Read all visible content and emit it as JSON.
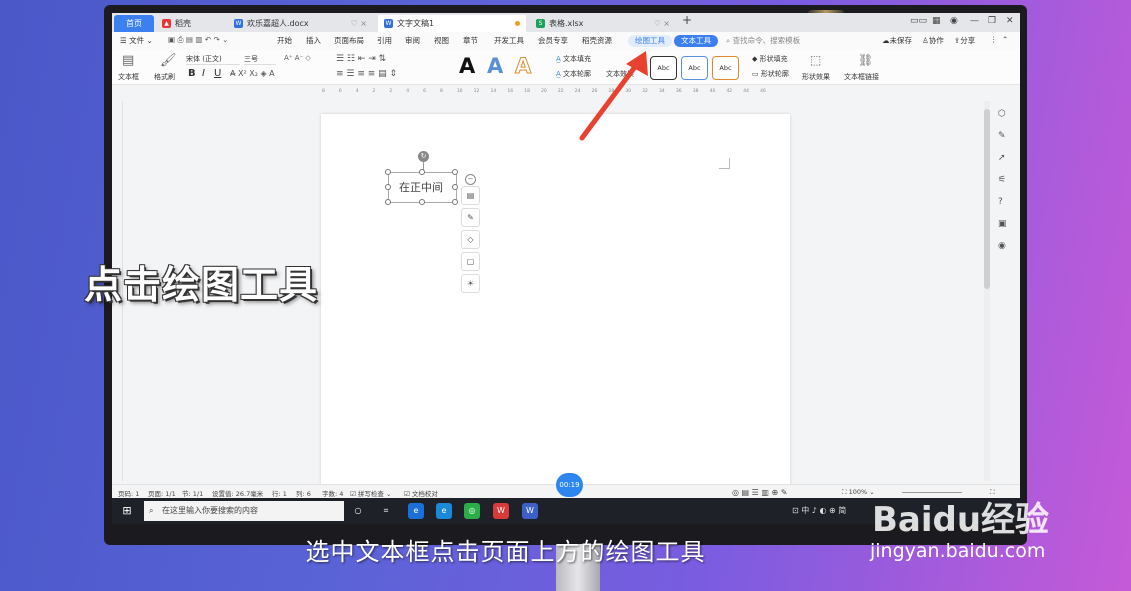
{
  "tabs": [
    {
      "label": "首页",
      "kind": "home"
    },
    {
      "label": "稻壳",
      "icon": "wps-docer-icon"
    },
    {
      "label": "欢乐嘉超人.docx",
      "icon": "word-doc-icon"
    },
    {
      "label": "文字文稿1",
      "icon": "word-doc-icon",
      "active": true
    },
    {
      "label": "表格.xlsx",
      "icon": "sheet-icon"
    }
  ],
  "menu": {
    "file": "文件",
    "items": [
      "开始",
      "插入",
      "页面布局",
      "引用",
      "审阅",
      "视图",
      "章节",
      "开发工具",
      "会员专享",
      "稻壳资源"
    ],
    "drawing_tools": "绘图工具",
    "text_tools": "文本工具",
    "search_placeholder": "查找命令、搜索模板",
    "unsaved": "未保存",
    "collab": "协作",
    "share": "分享"
  },
  "ribbon": {
    "textbox": "文本框",
    "format_painter": "格式刷",
    "font_name": "宋体 (正文)",
    "font_size": "三号",
    "text_fill": "文本填充",
    "text_outline": "文本轮廓",
    "text_effect": "文本效果",
    "style_samples": [
      "Abc",
      "Abc",
      "Abc"
    ],
    "shape_fill": "形状填充",
    "shape_outline": "形状轮廓",
    "shape_effect": "形状效果",
    "textbox_link": "文本框链接",
    "bold": "B",
    "italic": "I",
    "underline": "U",
    "big_a": "A"
  },
  "ruler_ticks": [
    "8",
    "6",
    "4",
    "2",
    "2",
    "4",
    "6",
    "8",
    "10",
    "12",
    "14",
    "16",
    "18",
    "20",
    "22",
    "24",
    "26",
    "28",
    "30",
    "32",
    "34",
    "36",
    "38",
    "40",
    "42",
    "44",
    "46"
  ],
  "document": {
    "textbox_text": "在正中间"
  },
  "status": {
    "page": "页码: 1",
    "pages": "页面: 1/1",
    "section": "节: 1/1",
    "position": "设置值: 26.7毫米",
    "row": "行: 1",
    "col": "列: 6",
    "words": "字数: 4",
    "spell": "拼写检查",
    "proof": "文档校对",
    "zoom": "100%"
  },
  "taskbar": {
    "search_placeholder": "在这里输入你要搜索的内容",
    "tray_text": "中",
    "tray_ime": "简"
  },
  "overlay": {
    "timer": "00:19",
    "hint": "点击绘图工具",
    "subtitle": "选中文本框点击页面上方的绘图工具",
    "watermark": "Baidu经验",
    "watermark_url": "jingyan.baidu.com"
  },
  "colors": {
    "accent": "#3c7ff0",
    "arrow": "#e8412f"
  }
}
